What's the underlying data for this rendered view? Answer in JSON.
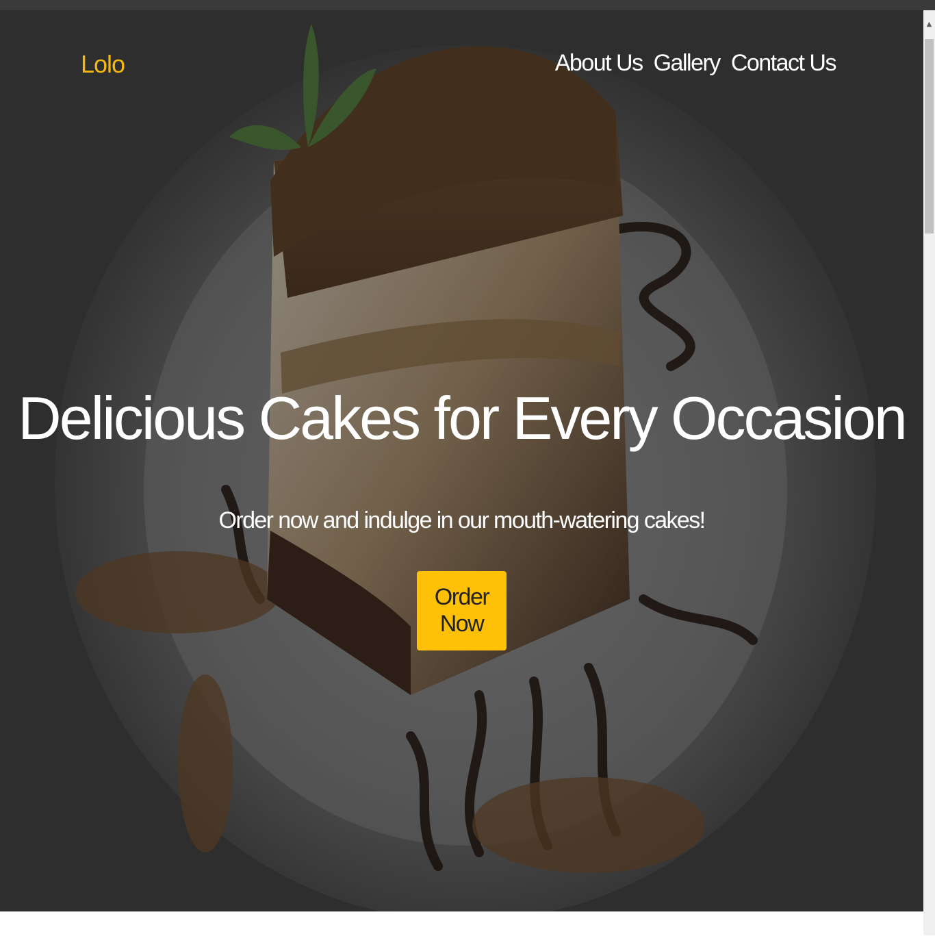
{
  "header": {
    "brand": "Lolo",
    "nav": [
      {
        "label": "About Us"
      },
      {
        "label": "Gallery"
      },
      {
        "label": "Contact Us"
      }
    ]
  },
  "hero": {
    "title": "Delicious Cakes for Every Occasion",
    "subtitle": "Order now and indulge in our mouth-watering cakes!",
    "cta_label": "Order Now",
    "background_image": "cake-slice-photo"
  },
  "colors": {
    "brand": "#f5b912",
    "cta_background": "#ffc107",
    "text": "#ffffff"
  }
}
